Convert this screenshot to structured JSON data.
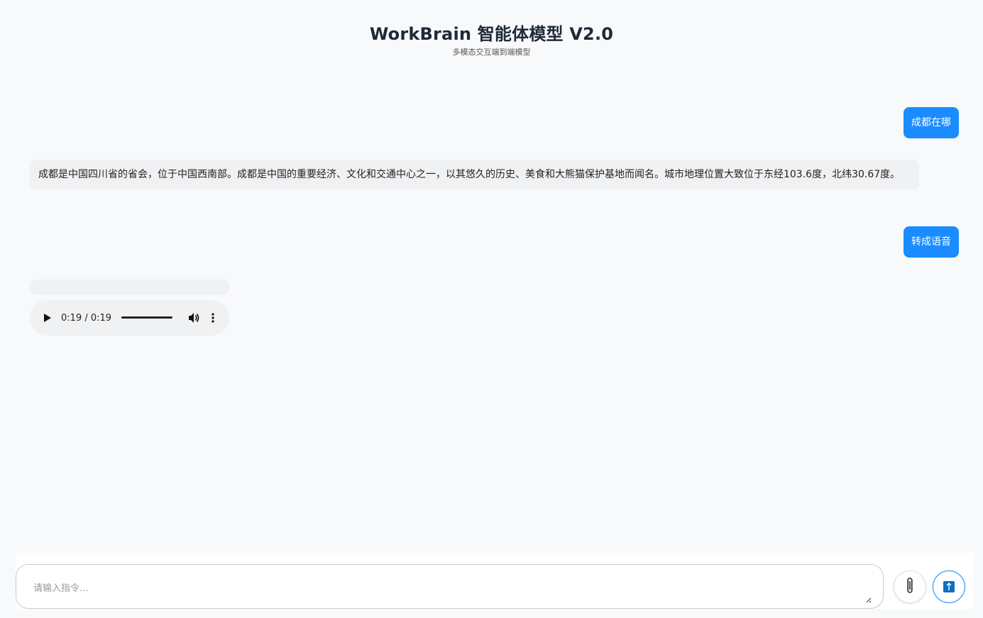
{
  "header": {
    "title": "WorkBrain 智能体模型 V2.0",
    "subtitle": "多模态交互端到端模型"
  },
  "messages": [
    {
      "role": "user",
      "text": "成都在哪"
    },
    {
      "role": "assistant",
      "text": "成都是中国四川省的省会，位于中国西南部。成都是中国的重要经济、文化和交通中心之一，以其悠久的历史、美食和大熊猫保护基地而闻名。城市地理位置大致位于东经103.6度，北纬30.67度。"
    },
    {
      "role": "user",
      "text": "转成语音"
    }
  ],
  "audio_player": {
    "time": "0:19 / 0:19",
    "progress": 1.0
  },
  "input": {
    "placeholder": "请输入指令..."
  },
  "icons": {
    "attach": "paperclip-icon",
    "send": "send-icon"
  },
  "colors": {
    "accent": "#1a8cff",
    "background": "#f8f9fa",
    "bot_bubble": "#f0f1f3"
  }
}
